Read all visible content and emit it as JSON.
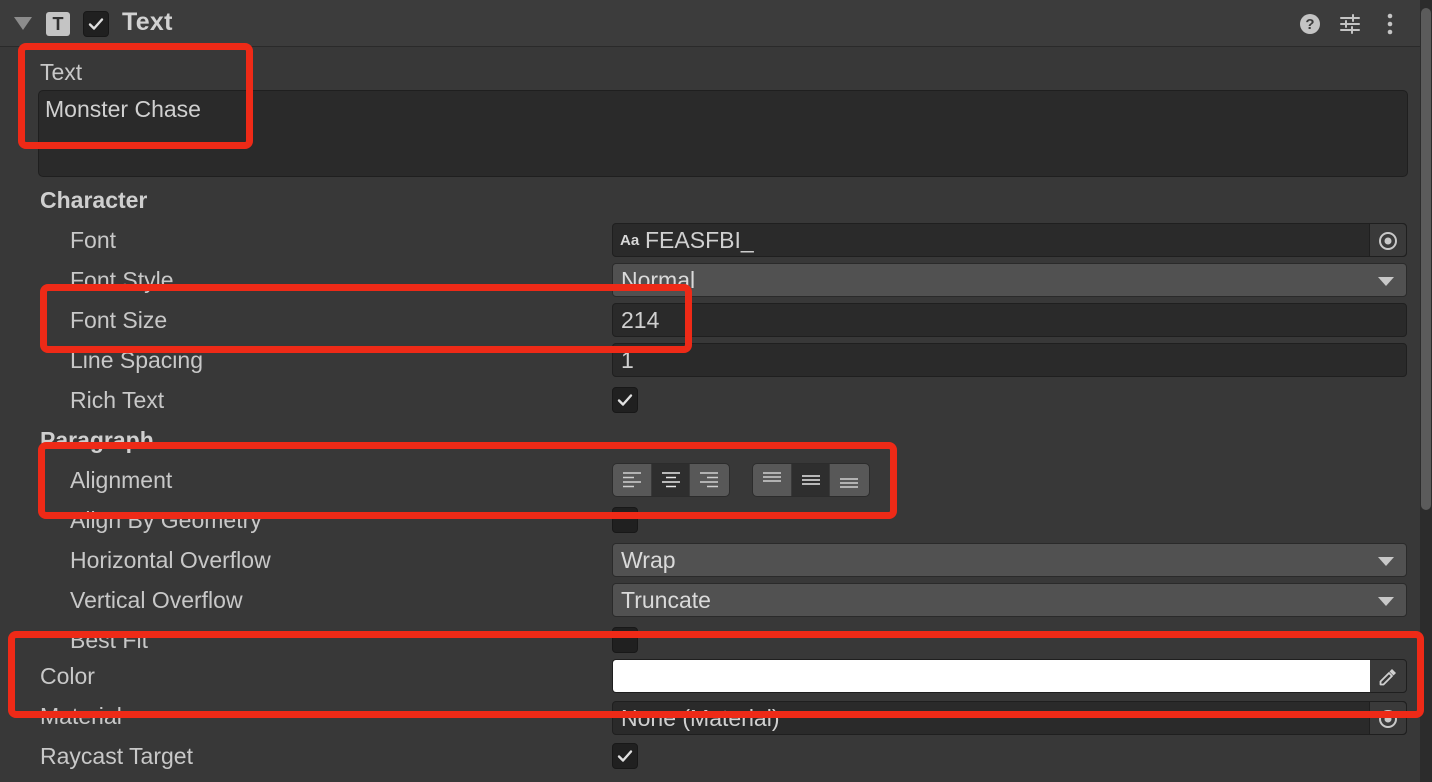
{
  "component": {
    "title": "Text",
    "icon": "text-component-icon",
    "enabled": true
  },
  "text_section": {
    "label": "Text",
    "value": "Monster Chase"
  },
  "character": {
    "heading": "Character",
    "font_label": "Font",
    "font_value": "FEASFBI_",
    "font_icon_text": "Aa",
    "font_style_label": "Font Style",
    "font_style_value": "Normal",
    "font_size_label": "Font Size",
    "font_size_value": "214",
    "line_spacing_label": "Line Spacing",
    "line_spacing_value": "1",
    "rich_text_label": "Rich Text",
    "rich_text_checked": true
  },
  "paragraph": {
    "heading": "Paragraph",
    "alignment_label": "Alignment",
    "horizontal_alignment": [
      "left",
      "center",
      "right"
    ],
    "horizontal_selected": "center",
    "vertical_alignment": [
      "top",
      "middle",
      "bottom"
    ],
    "vertical_selected": "middle",
    "align_by_geometry_label": "Align By Geometry",
    "align_by_geometry_checked": false,
    "horizontal_overflow_label": "Horizontal Overflow",
    "horizontal_overflow_value": "Wrap",
    "vertical_overflow_label": "Vertical Overflow",
    "vertical_overflow_value": "Truncate",
    "best_fit_label": "Best Fit",
    "best_fit_checked": false
  },
  "color": {
    "label": "Color",
    "value": "#FFFFFF"
  },
  "material": {
    "label": "Material",
    "value": "None (Material)"
  },
  "raycast": {
    "label": "Raycast Target",
    "checked": true
  },
  "annotation_color": "#EE2A17"
}
